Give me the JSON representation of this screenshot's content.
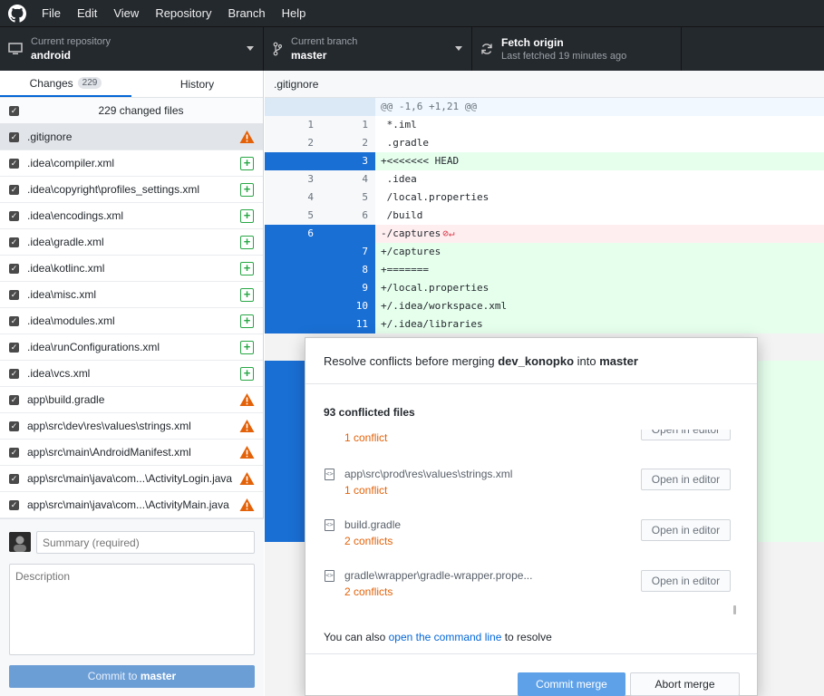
{
  "menu": {
    "items": [
      "File",
      "Edit",
      "View",
      "Repository",
      "Branch",
      "Help"
    ]
  },
  "toolbar": {
    "repo_label": "Current repository",
    "repo_value": "android",
    "branch_label": "Current branch",
    "branch_value": "master",
    "fetch_label": "Fetch origin",
    "fetch_status": "Last fetched 19 minutes ago"
  },
  "sidebar": {
    "tabs": [
      {
        "label": "Changes",
        "badge": "229"
      },
      {
        "label": "History"
      }
    ],
    "changed_summary": "229 changed files",
    "files": [
      {
        "name": ".gitignore",
        "status": "conflict"
      },
      {
        "name": ".idea\\compiler.xml",
        "status": "added"
      },
      {
        "name": ".idea\\copyright\\profiles_settings.xml",
        "status": "added"
      },
      {
        "name": ".idea\\encodings.xml",
        "status": "added"
      },
      {
        "name": ".idea\\gradle.xml",
        "status": "added"
      },
      {
        "name": ".idea\\kotlinc.xml",
        "status": "added"
      },
      {
        "name": ".idea\\misc.xml",
        "status": "added"
      },
      {
        "name": ".idea\\modules.xml",
        "status": "added"
      },
      {
        "name": ".idea\\runConfigurations.xml",
        "status": "added"
      },
      {
        "name": ".idea\\vcs.xml",
        "status": "added"
      },
      {
        "name": "app\\build.gradle",
        "status": "conflict"
      },
      {
        "name": "app\\src\\dev\\res\\values\\strings.xml",
        "status": "conflict"
      },
      {
        "name": "app\\src\\main\\AndroidManifest.xml",
        "status": "conflict"
      },
      {
        "name": "app\\src\\main\\java\\com...\\ActivityLogin.java",
        "status": "conflict"
      },
      {
        "name": "app\\src\\main\\java\\com...\\ActivityMain.java",
        "status": "conflict"
      }
    ],
    "add_symbol": "+",
    "summary_placeholder": "Summary (required)",
    "description_placeholder": "Description",
    "commit_prefix": "Commit to",
    "commit_branch": "master"
  },
  "diff": {
    "filename": ".gitignore",
    "hunk": "@@ -1,6 +1,21 @@",
    "lines": [
      {
        "type": "ctx",
        "old": "1",
        "new": "1",
        "text": " *.iml"
      },
      {
        "type": "ctx",
        "old": "2",
        "new": "2",
        "text": " .gradle"
      },
      {
        "type": "add",
        "old": "",
        "new": "3",
        "text": "+<<<<<<< HEAD"
      },
      {
        "type": "ctx",
        "old": "3",
        "new": "4",
        "text": " .idea"
      },
      {
        "type": "ctx",
        "old": "4",
        "new": "5",
        "text": " /local.properties"
      },
      {
        "type": "ctx",
        "old": "5",
        "new": "6",
        "text": " /build"
      },
      {
        "type": "del",
        "old": "6",
        "new": "",
        "text": "-/captures"
      },
      {
        "type": "add",
        "old": "",
        "new": "7",
        "text": "+/captures"
      },
      {
        "type": "add",
        "old": "",
        "new": "8",
        "text": "+======="
      },
      {
        "type": "add",
        "old": "",
        "new": "9",
        "text": "+/local.properties"
      },
      {
        "type": "add",
        "old": "",
        "new": "10",
        "text": "+/.idea/workspace.xml"
      },
      {
        "type": "add",
        "old": "",
        "new": "11",
        "text": "+/.idea/libraries"
      }
    ]
  },
  "modal": {
    "title_prefix": "Resolve conflicts before merging",
    "source_branch": "dev_konopko",
    "title_mid": "into",
    "target_branch": "master",
    "conflict_count": "93 conflicted files",
    "items": [
      {
        "path": "",
        "conflicts": "1 conflict",
        "button": "Open in editor"
      },
      {
        "path": "app\\src\\prod\\res\\values\\strings.xml",
        "conflicts": "1 conflict",
        "button": "Open in editor"
      },
      {
        "path": "build.gradle",
        "conflicts": "2 conflicts",
        "button": "Open in editor"
      },
      {
        "path": "gradle\\wrapper\\gradle-wrapper.prope...",
        "conflicts": "2 conflicts",
        "button": "Open in editor"
      }
    ],
    "cmd_prefix": "You can also",
    "cmd_link": "open the command line",
    "cmd_suffix": "to resolve",
    "commit_merge": "Commit merge",
    "abort_merge": "Abort merge"
  },
  "colors": {
    "accent": "#0366d6",
    "conflict": "#e36209",
    "added": "#28a745",
    "toolbar_bg": "#24292e"
  }
}
